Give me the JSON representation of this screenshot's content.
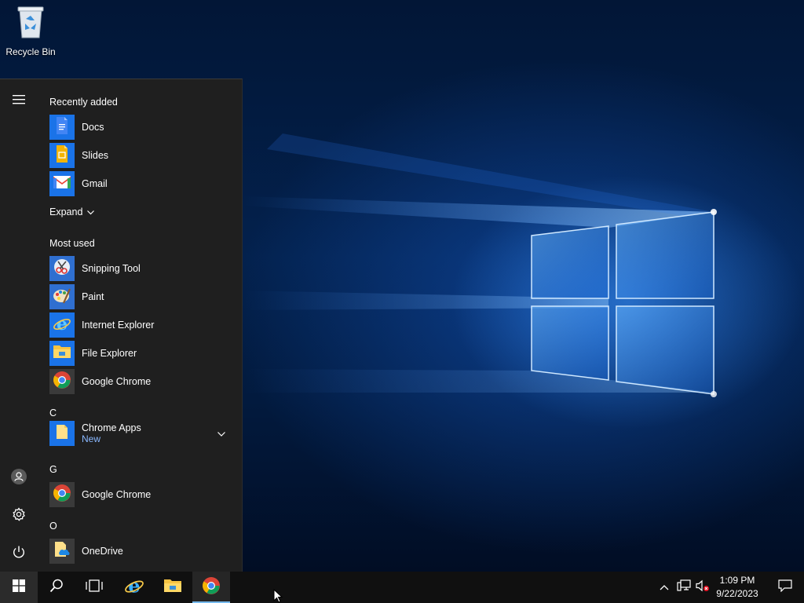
{
  "desktop": {
    "icons": [
      {
        "label": "Recycle Bin",
        "icon": "recycle-bin-icon"
      }
    ]
  },
  "start_menu": {
    "rail": {
      "menu": "hamburger-menu-icon",
      "user": "user-account-icon",
      "settings": "gear-icon",
      "power": "power-icon"
    },
    "recently_added": {
      "header": "Recently added",
      "items": [
        {
          "label": "Docs",
          "icon": "google-docs-icon",
          "tile_color": "#1a73e8"
        },
        {
          "label": "Slides",
          "icon": "google-slides-icon",
          "tile_color": "#1a73e8"
        },
        {
          "label": "Gmail",
          "icon": "gmail-icon",
          "tile_color": "#1a73e8"
        }
      ],
      "expand_label": "Expand"
    },
    "most_used": {
      "header": "Most used",
      "items": [
        {
          "label": "Snipping Tool",
          "icon": "snipping-tool-icon"
        },
        {
          "label": "Paint",
          "icon": "paint-icon"
        },
        {
          "label": "Internet Explorer",
          "icon": "internet-explorer-icon"
        },
        {
          "label": "File Explorer",
          "icon": "file-explorer-icon"
        },
        {
          "label": "Google Chrome",
          "icon": "google-chrome-icon"
        }
      ]
    },
    "alpha_groups": [
      {
        "letter": "C",
        "items": [
          {
            "label": "Chrome Apps",
            "sub": "New",
            "icon": "folder-icon",
            "expandable": true
          }
        ]
      },
      {
        "letter": "G",
        "items": [
          {
            "label": "Google Chrome",
            "icon": "google-chrome-icon"
          }
        ]
      },
      {
        "letter": "O",
        "items": [
          {
            "label": "OneDrive",
            "icon": "onedrive-folder-icon"
          }
        ]
      }
    ]
  },
  "taskbar": {
    "start": "windows-start-icon",
    "search": "search-icon",
    "task_view": "task-view-icon",
    "pinned": [
      {
        "name": "Internet Explorer",
        "icon": "internet-explorer-icon"
      },
      {
        "name": "File Explorer",
        "icon": "file-explorer-icon"
      },
      {
        "name": "Google Chrome",
        "icon": "google-chrome-icon",
        "active": true
      }
    ],
    "tray": {
      "overflow": "chevron-up-icon",
      "network": "network-icon",
      "volume": "volume-muted-icon",
      "notifications": "action-center-icon"
    },
    "clock": {
      "time": "1:09 PM",
      "date": "9/22/2023"
    }
  },
  "colors": {
    "accent": "#1a73e8",
    "taskbar_bg": "#101010",
    "start_bg": "#1f1f1f",
    "active_underline": "#76b9ed",
    "sub_text": "#8ab8ff"
  }
}
